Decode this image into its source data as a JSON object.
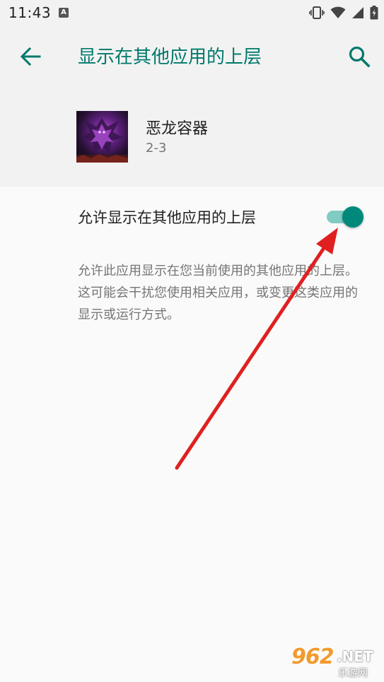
{
  "status_bar": {
    "time": "11:43",
    "a_icon_letter": "A",
    "icons": [
      "font-a-icon",
      "vibrate-icon",
      "wifi-icon",
      "signal-icon",
      "battery-charging-icon"
    ]
  },
  "header": {
    "title": "显示在其他应用的上层",
    "back_icon": "arrow-back-icon",
    "search_icon": "search-icon"
  },
  "app": {
    "name": "恶龙容器",
    "version": "2-3"
  },
  "setting": {
    "label": "允许显示在其他应用的上层",
    "enabled": true,
    "summary": "允许此应用显示在您当前使用的其他应用的上层。这可能会干扰您使用相关应用，或变更这类应用的显示或运行方式。"
  },
  "watermark": {
    "number": "962",
    "suffix": ".NET",
    "sub": "乐游网"
  },
  "colors": {
    "accent": "#00796b",
    "toggle_thumb": "#00897b",
    "toggle_track": "#80cbc4",
    "annotation": "#e02020"
  }
}
